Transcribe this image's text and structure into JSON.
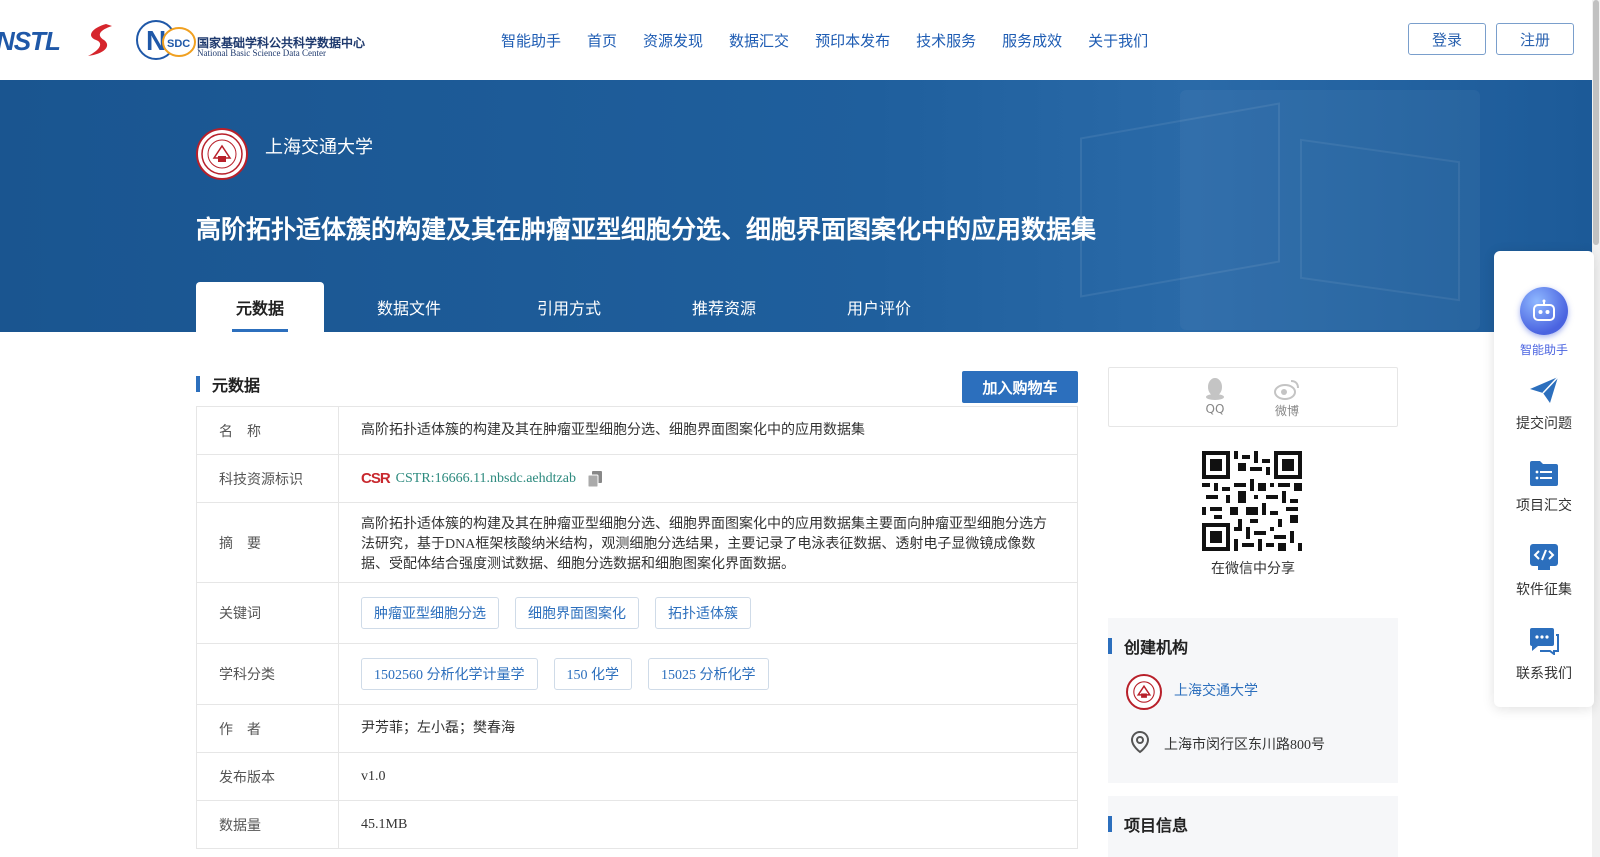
{
  "header": {
    "logos": [
      "NSTL",
      "NSDC"
    ],
    "nsdc_cn": "国家基础学科公共科学数据中心",
    "nsdc_en": "National Basic Science Data Center",
    "nav": [
      "智能助手",
      "首页",
      "资源发现",
      "数据汇交",
      "预印本发布",
      "技术服务",
      "服务成效",
      "关于我们"
    ],
    "login": "登录",
    "register": "注册"
  },
  "banner": {
    "institution": "上海交通大学",
    "title": "高阶拓扑适体簇的构建及其在肿瘤亚型细胞分选、细胞界面图案化中的应用数据集",
    "tabs": [
      "元数据",
      "数据文件",
      "引用方式",
      "推荐资源",
      "用户评价"
    ],
    "active_tab": "元数据"
  },
  "metadata": {
    "section_title": "元数据",
    "cart_button": "加入购物车",
    "rows": {
      "name": {
        "label": "名　称",
        "value": "高阶拓扑适体簇的构建及其在肿瘤亚型细胞分选、细胞界面图案化中的应用数据集"
      },
      "cstr": {
        "label": "科技资源标识",
        "logo": "CSR",
        "value": "CSTR:16666.11.nbsdc.aehdtzab"
      },
      "abstract": {
        "label": "摘　要",
        "value": "高阶拓扑适体簇的构建及其在肿瘤亚型细胞分选、细胞界面图案化中的应用数据集主要面向肿瘤亚型细胞分选方法研究，基于DNA框架核酸纳米结构，观测细胞分选结果，主要记录了电泳表征数据、透射电子显微镜成像数据、受配体结合强度测试数据、细胞分选数据和细胞图案化界面数据。"
      },
      "keywords": {
        "label": "关键词",
        "tags": [
          "肿瘤亚型细胞分选",
          "细胞界面图案化",
          "拓扑适体簇"
        ]
      },
      "subjects": {
        "label": "学科分类",
        "tags": [
          "1502560 分析化学计量学",
          "150 化学",
          "15025 分析化学"
        ]
      },
      "authors": {
        "label": "作　者",
        "value": "尹芳菲；左小磊；樊春海"
      },
      "version": {
        "label": "发布版本",
        "value": "v1.0"
      },
      "size": {
        "label": "数据量",
        "value": "45.1MB"
      }
    }
  },
  "share": {
    "qq": "QQ",
    "weibo": "微博",
    "wechat_caption": "在微信中分享"
  },
  "creator": {
    "title": "创建机构",
    "name": "上海交通大学",
    "address": "上海市闵行区东川路800号"
  },
  "project": {
    "title": "项目信息"
  },
  "float_bar": {
    "items": [
      {
        "label": "智能助手",
        "icon": "robot-icon"
      },
      {
        "label": "提交问题",
        "icon": "paper-plane-icon"
      },
      {
        "label": "项目汇交",
        "icon": "folder-list-icon"
      },
      {
        "label": "软件征集",
        "icon": "code-icon"
      },
      {
        "label": "联系我们",
        "icon": "chat-icon"
      }
    ]
  },
  "colors": {
    "brand_blue": "#2c6fbd",
    "banner_blue": "#1f5f9d",
    "sjtu_red": "#b8202a",
    "cstr_teal": "#2c8a7e"
  }
}
